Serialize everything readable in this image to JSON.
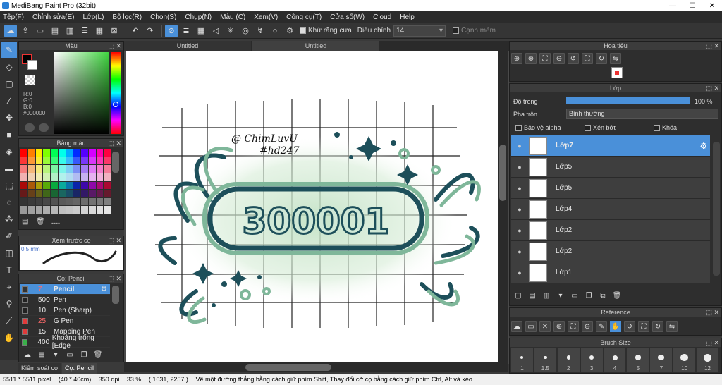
{
  "window": {
    "title": "MediBang Paint Pro (32bit)",
    "minimize": "—",
    "maximize": "☐",
    "close": "✕"
  },
  "menu": [
    "Tệp(F)",
    "Chỉnh sửa(E)",
    "Lớp(L)",
    "Bộ lọc(R)",
    "Chọn(S)",
    "Chụp(N)",
    "Màu (C)",
    "Xem(V)",
    "Công cụ(T)",
    "Cửa sổ(W)",
    "Cloud",
    "Help"
  ],
  "toolbar": {
    "antialias_label": "Khử răng cưa",
    "adjust_label": "Điều chỉnh",
    "adjust_value": "14",
    "trim_label": "Cạnh mềm"
  },
  "color_panel": {
    "title": "Màu",
    "r": "R:0",
    "g": "G:0",
    "b": "B:0",
    "hex": "#000000"
  },
  "palette_panel": {
    "title": "Bảng màu",
    "dots": "----"
  },
  "brush_preview": {
    "title": "Xem trước cọ",
    "size": "0.5 mm"
  },
  "brush_panel": {
    "title": "Cọ: Pencil",
    "items": [
      {
        "num": "7",
        "name": "Pencil",
        "color": "#333333",
        "num_color": "#ff6a6a"
      },
      {
        "num": "500",
        "name": "Pen",
        "color": "#222222",
        "num_color": "#e8e8e8"
      },
      {
        "num": "10",
        "name": "Pen (Sharp)",
        "color": "#222222",
        "num_color": "#e8e8e8"
      },
      {
        "num": "25",
        "name": "G Pen",
        "color": "#e03a3a",
        "num_color": "#ff6a6a"
      },
      {
        "num": "15",
        "name": "Mapping Pen",
        "color": "#e03a3a",
        "num_color": "#e8e8e8"
      },
      {
        "num": "400",
        "name": "Khoảng trống [Edge",
        "color": "#3ab04a",
        "num_color": "#e8e8e8"
      }
    ]
  },
  "bottom_tabs": [
    "Kiểm soát cọ",
    "Cọ: Pencil"
  ],
  "doc_tabs": [
    "Untitled",
    "Untitled"
  ],
  "artwork": {
    "handwriting_line1": "@ ChimLuvU",
    "handwriting_line2": "#hd247",
    "number": "300001"
  },
  "navigator": {
    "title": "Hoa tiêu"
  },
  "layer_panel": {
    "title": "Lớp",
    "opacity_label": "Độ trong",
    "opacity_value": "100 %",
    "opacity_fraction": 1.0,
    "blend_label": "Pha trộn",
    "blend_value": "Bình thường",
    "protect_alpha": "Bảo vệ alpha",
    "clipping": "Xén bớt",
    "lock": "Khóa",
    "layers": [
      "Lớp7",
      "Lớp5",
      "Lớp5",
      "Lớp4",
      "Lớp2",
      "Lớp2",
      "Lớp1"
    ]
  },
  "reference": {
    "title": "Reference"
  },
  "brush_size": {
    "title": "Brush Size",
    "sizes": [
      "1",
      "1.5",
      "2",
      "3",
      "4",
      "5",
      "7",
      "10",
      "12"
    ]
  },
  "status": {
    "size": "5511 * 5511 pixel",
    "cm": "(40 * 40cm)",
    "dpi": "350 dpi",
    "zoom": "33 %",
    "coords": "( 1631, 2257 )",
    "hint": "Vẽ một đường thẳng bằng cách giữ phím Shift, Thay đổi cỡ cọ bằng cách giữ phím Ctrl, Alt và kéo"
  },
  "colors": {
    "accent": "#4a90d9",
    "ink_dark": "#1d4f5a",
    "ink_green": "#7fb79a",
    "wash": "#cfe8cf"
  }
}
